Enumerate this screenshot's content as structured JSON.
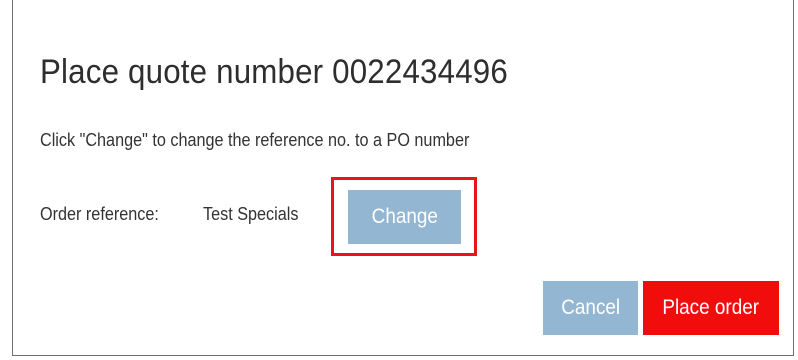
{
  "dialog": {
    "title": "Place quote number 0022434496",
    "instruction": "Click \"Change\" to change the reference no. to a PO number",
    "order_reference_label": "Order reference:",
    "order_reference_value": "Test Specials",
    "change_label": "Change",
    "cancel_label": "Cancel",
    "place_order_label": "Place order"
  },
  "colors": {
    "secondary_button": "#93b6d2",
    "primary_button": "#f20d0d",
    "highlight_border": "#e8141c",
    "text": "#333333"
  }
}
